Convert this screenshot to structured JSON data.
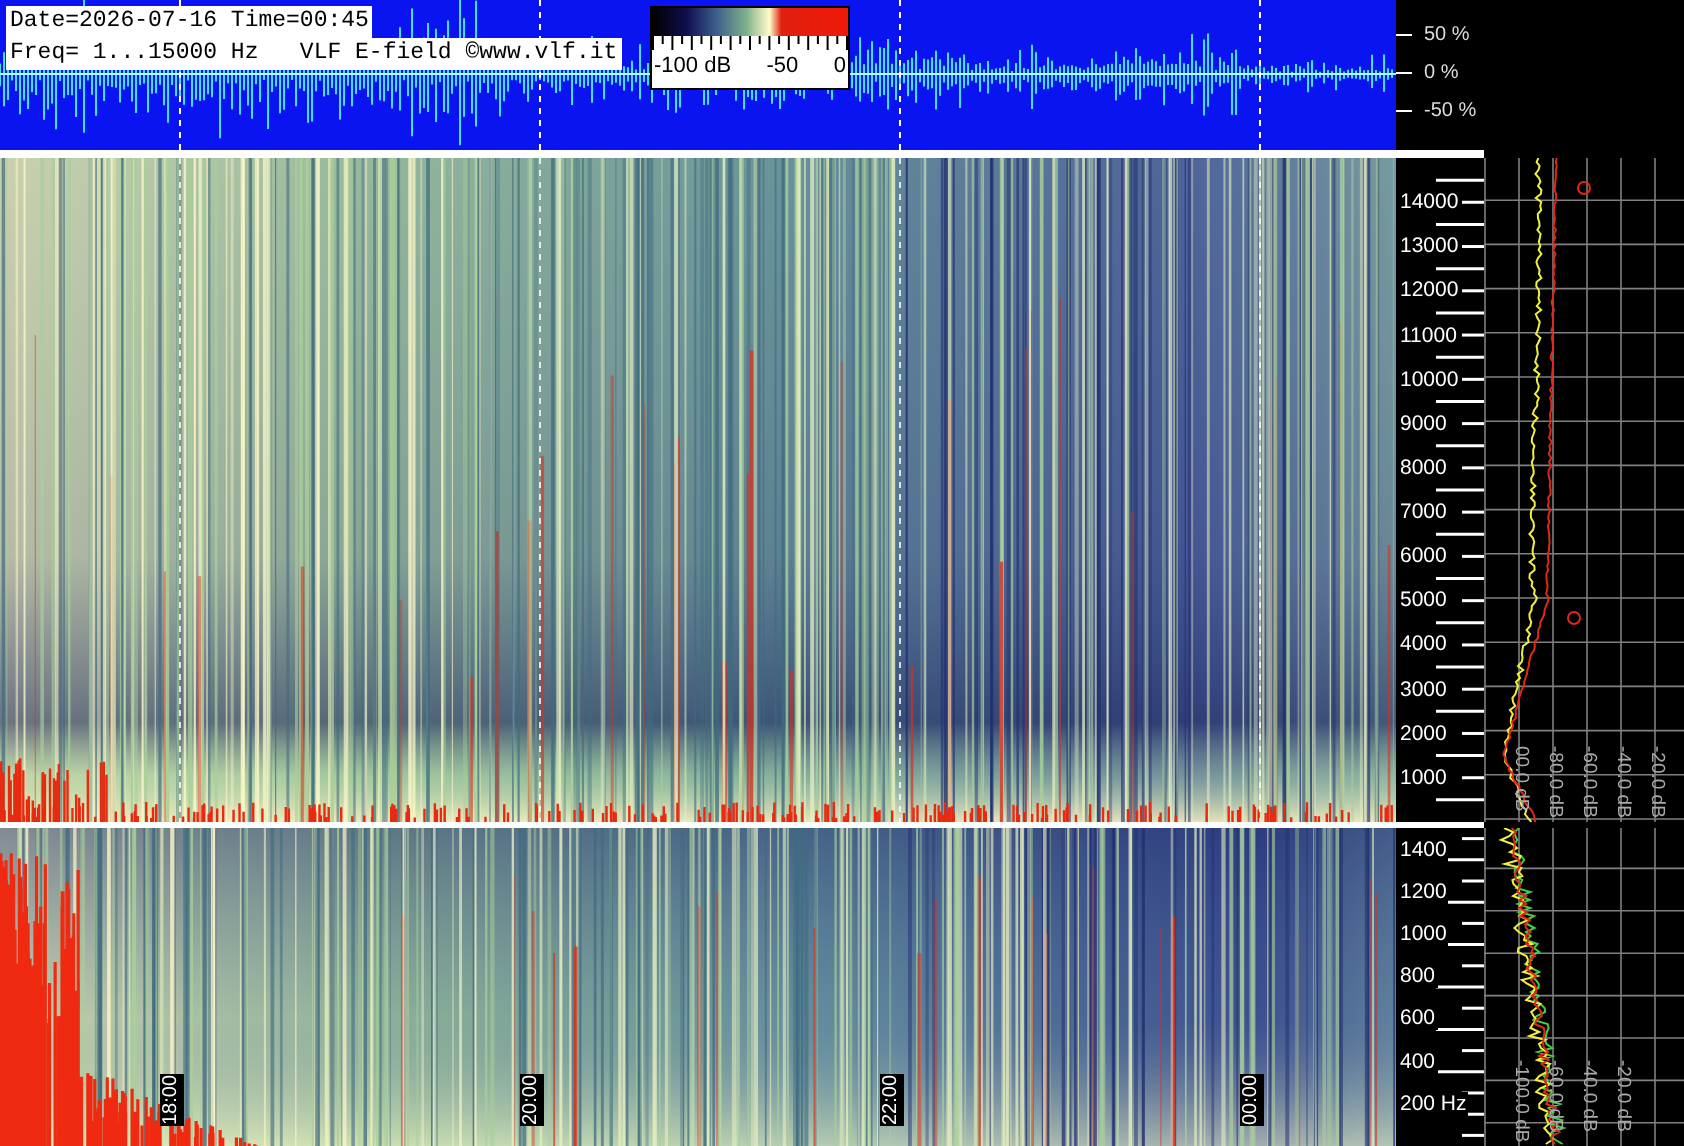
{
  "header": {
    "date_line": "Date=2026-07-16 Time=00:45",
    "freq_line": "Freq= 1...15000 Hz   VLF E-field ©www.vlf.it"
  },
  "color_scale": {
    "labels": [
      "-100 dB",
      "-50",
      "0"
    ]
  },
  "waveform_axis": {
    "labels": [
      "50 %",
      "0 %",
      "-50 %"
    ]
  },
  "time_labels": [
    "18:00",
    "20:00",
    "22:00",
    "00:00"
  ],
  "upper_panel": {
    "freq_labels": [
      "14000",
      "13000",
      "12000",
      "11000",
      "10000",
      "9000",
      "8000",
      "7000",
      "6000",
      "5000",
      "4000",
      "3000",
      "2000",
      "1000"
    ],
    "db_labels": [
      "00.0 dB",
      "-80.0 dB",
      "-60.0 dB",
      "-40.0 dB",
      "-20.0 dB"
    ]
  },
  "lower_panel": {
    "freq_labels": [
      "1400",
      "1200",
      "1000",
      "800",
      "600",
      "400",
      "200 Hz"
    ],
    "db_labels": [
      "-100.0 dB",
      "-60.0 dB",
      "-40.0 dB",
      "-20.0 dB"
    ]
  }
}
